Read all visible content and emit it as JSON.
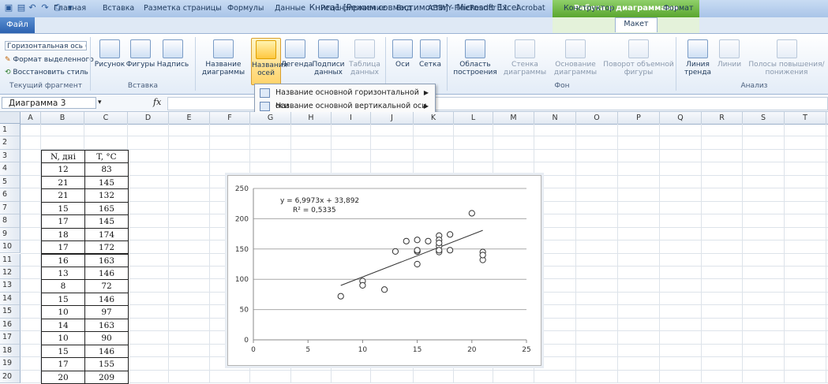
{
  "window": {
    "title": "Книга1  [Режим совместимости]  -  Microsoft Excel",
    "context_group": "Работа с диаграммами"
  },
  "tabs": {
    "file": "Файл",
    "items": [
      "Главная",
      "Вставка",
      "Разметка страницы",
      "Формулы",
      "Данные",
      "Рецензирование",
      "Вид",
      "ABBYY FineReader 11",
      "Acrobat",
      "Конструктор",
      "Макет",
      "Формат"
    ],
    "active": "Макет"
  },
  "ribbon": {
    "current_fragment": {
      "selector": "Горизонтальная ось (зн",
      "format_selection": "Формат выделенного",
      "reset_style": "Восстановить стиль",
      "label": "Текущий фрагмент"
    },
    "insert": {
      "picture": "Рисунок",
      "shapes": "Фигуры",
      "textbox": "Надпись",
      "label": "Вставка"
    },
    "labels_group": {
      "chart_title": "Название диаграммы",
      "axis_titles": "Названия осей",
      "legend": "Легенда",
      "data_labels": "Подписи данных",
      "data_table": "Таблица данных"
    },
    "axes_group": {
      "axes": "Оси",
      "gridlines": "Сетка"
    },
    "background": {
      "plot_area": "Область построения",
      "wall": "Стенка диаграммы",
      "floor": "Основание диаграммы",
      "rotation": "Поворот объемной фигуры",
      "label": "Фон"
    },
    "analysis": {
      "trendline": "Линия тренда",
      "lines": "Линии",
      "updown_bars": "Полосы повышения/понижения",
      "label": "Анализ"
    }
  },
  "dropdown": {
    "items": [
      "Название основной горизонтальной оси",
      "Название основной вертикальной оси"
    ]
  },
  "formula_bar": {
    "name_box": "Диаграмма 3",
    "fx": "fx"
  },
  "sheet": {
    "columns": [
      "A",
      "B",
      "C",
      "D",
      "E",
      "F",
      "G",
      "H",
      "I",
      "J",
      "K",
      "L",
      "M",
      "N",
      "O",
      "P",
      "Q",
      "R",
      "S",
      "T"
    ],
    "rows": [
      "1",
      "2",
      "3",
      "4",
      "5",
      "6",
      "7",
      "8",
      "9",
      "10",
      "11",
      "12",
      "13",
      "14",
      "15",
      "16",
      "17",
      "18",
      "19",
      "20"
    ],
    "table_header": [
      "N, дні",
      "T, °C"
    ],
    "table_rows": [
      [
        "12",
        "83"
      ],
      [
        "21",
        "145"
      ],
      [
        "21",
        "132"
      ],
      [
        "15",
        "165"
      ],
      [
        "17",
        "145"
      ],
      [
        "18",
        "174"
      ],
      [
        "17",
        "172"
      ],
      [
        "16",
        "163"
      ],
      [
        "13",
        "146"
      ],
      [
        "8",
        "72"
      ],
      [
        "15",
        "146"
      ],
      [
        "10",
        "97"
      ],
      [
        "14",
        "163"
      ],
      [
        "10",
        "90"
      ],
      [
        "15",
        "146"
      ],
      [
        "17",
        "155"
      ],
      [
        "20",
        "209"
      ]
    ]
  },
  "chart_data": {
    "type": "scatter",
    "x": [
      12,
      21,
      21,
      15,
      17,
      18,
      17,
      16,
      13,
      8,
      15,
      10,
      14,
      10,
      15,
      17,
      20,
      15,
      17,
      18,
      17,
      15,
      17,
      21
    ],
    "y": [
      83,
      145,
      132,
      165,
      145,
      174,
      172,
      163,
      146,
      72,
      146,
      97,
      163,
      90,
      146,
      155,
      209,
      125,
      165,
      148,
      148,
      148,
      160,
      140
    ],
    "xlim": [
      0,
      25
    ],
    "ylim": [
      0,
      250
    ],
    "xticks": [
      "0",
      "5",
      "10",
      "15",
      "20",
      "25"
    ],
    "yticks": [
      "0",
      "50",
      "100",
      "150",
      "200",
      "250"
    ],
    "trendline": {
      "slope": 6.9973,
      "intercept": 33.892,
      "x_range": [
        8,
        21
      ]
    },
    "equation": "y = 6,9973x + 33,892",
    "r_squared": "R² = 0,5335",
    "grid": "horizontal",
    "marker_color": "#333333",
    "line_color": "#333333"
  }
}
